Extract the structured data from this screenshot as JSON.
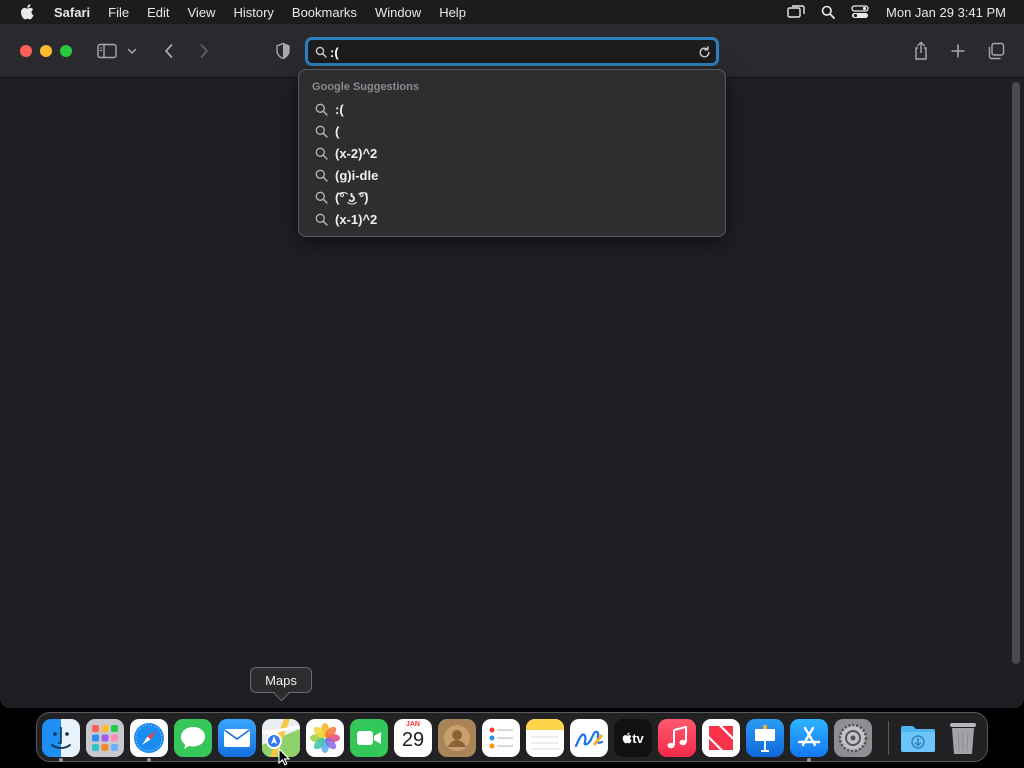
{
  "menubar": {
    "app_name": "Safari",
    "items": [
      "File",
      "Edit",
      "View",
      "History",
      "Bookmarks",
      "Window",
      "Help"
    ],
    "clock": "Mon Jan 29  3:41 PM"
  },
  "address_bar": {
    "value": ":("
  },
  "suggestions": {
    "header": "Google Suggestions",
    "items": [
      ":(",
      "(",
      "(x-2)^2",
      "(g)i-dle",
      "(͡° ͜ʖ ͡°)",
      "(x-1)^2"
    ]
  },
  "tooltip": {
    "label": "Maps"
  },
  "dock": {
    "calendar_month": "JAN",
    "calendar_day": "29",
    "tv_label": "tv",
    "apps": [
      "finder",
      "launchpad",
      "safari",
      "messages",
      "mail",
      "maps",
      "photos",
      "facetime",
      "calendar",
      "contacts",
      "reminders",
      "notes",
      "freeform",
      "tv",
      "music",
      "news",
      "keynote",
      "app-store",
      "system-settings",
      "downloads",
      "trash"
    ]
  },
  "colors": {
    "accent": "#2e7fbf",
    "close": "#fe5f57",
    "minimize": "#febc2e",
    "maximize": "#28c840"
  }
}
